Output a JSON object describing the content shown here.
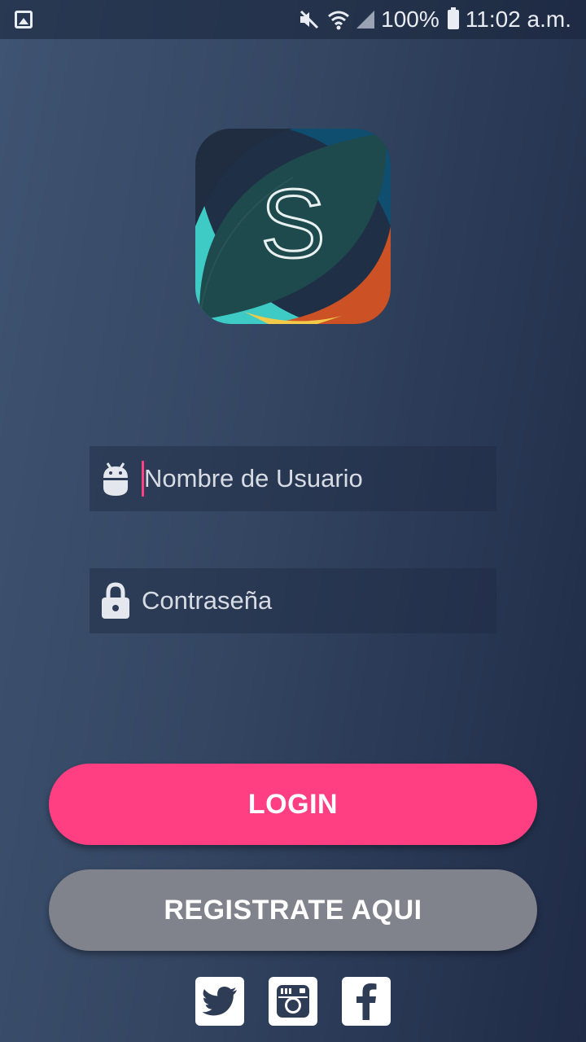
{
  "status_bar": {
    "battery": "100%",
    "time": "11:02 a.m."
  },
  "logo": {
    "letter": "S"
  },
  "form": {
    "username_placeholder": "Nombre de Usuario",
    "password_placeholder": "Contraseña"
  },
  "buttons": {
    "login_label": "LOGIN",
    "register_label": "REGISTRATE AQUI"
  },
  "social": [
    {
      "icon": "twitter-icon"
    },
    {
      "icon": "instagram-icon"
    },
    {
      "icon": "facebook-icon"
    }
  ],
  "colors": {
    "accent": "#ff3f82",
    "secondary_button": "#80828c",
    "background_start": "#3f5472",
    "background_end": "#1f2b47"
  }
}
